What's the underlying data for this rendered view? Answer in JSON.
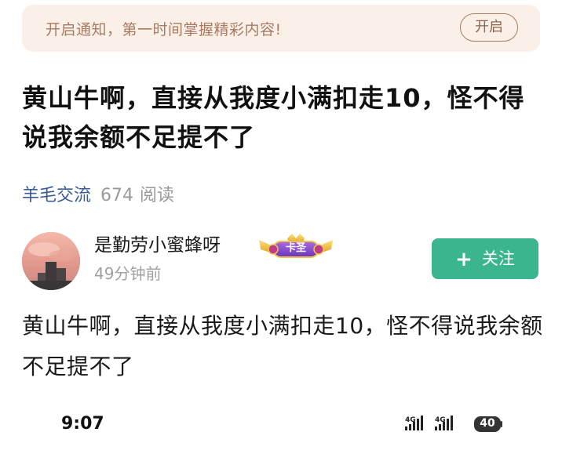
{
  "notice": {
    "text": "开启通知，第一时间掌握精彩内容!",
    "button_label": "开启"
  },
  "post": {
    "title": "黄山牛啊，直接从我度小满扣走10，怪不得说我余额不足提不了",
    "community": "羊毛交流",
    "views_count": "674",
    "views_label": "阅读",
    "content": "黄山牛啊，直接从我度小满扣走10，怪不得说我余额不足提不了"
  },
  "author": {
    "name": "是勤劳小蜜蜂呀",
    "badge_label": "卡圣",
    "time": "49分钟前",
    "follow_label": "关注",
    "follow_icon": "plus-icon"
  },
  "status_bar": {
    "time": "9:07",
    "signal_1": "4G",
    "signal_2": "4G",
    "battery": "40"
  },
  "colors": {
    "accent_green": "#3bb58f",
    "community_blue": "#3a5d95",
    "notice_bg": "#fbf0e8",
    "notice_text": "#a77b63"
  }
}
